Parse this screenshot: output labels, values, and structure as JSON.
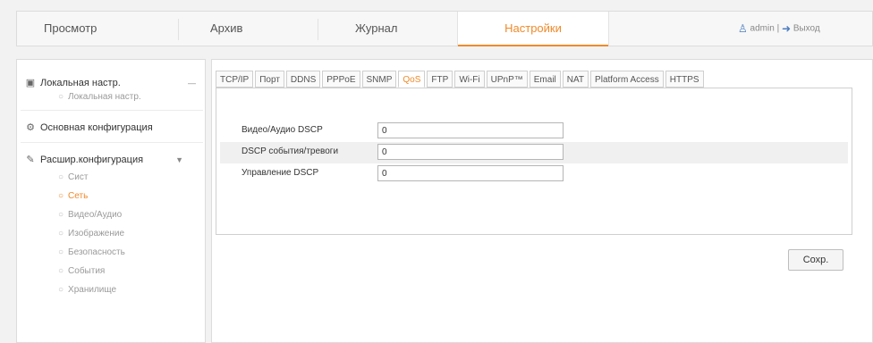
{
  "nav": {
    "tabs": [
      {
        "label": "Просмотр"
      },
      {
        "label": "Архив"
      },
      {
        "label": "Журнал"
      },
      {
        "label": "Настройки"
      }
    ],
    "user": {
      "name": "admin",
      "separator": "|",
      "logout": "Выход"
    }
  },
  "sidebar": {
    "groups": [
      {
        "label": "Локальная настр.",
        "icon": "monitor-icon",
        "items": [
          {
            "label": "Локальная настр."
          }
        ]
      },
      {
        "label": "Основная конфигурация",
        "icon": "gear-icon"
      },
      {
        "label": "Расшир.конфигурация",
        "icon": "wrench-icon",
        "items": [
          {
            "label": "Сист"
          },
          {
            "label": "Сеть"
          },
          {
            "label": "Видео/Аудио"
          },
          {
            "label": "Изображение"
          },
          {
            "label": "Безопасность"
          },
          {
            "label": "События"
          },
          {
            "label": "Хранилище"
          }
        ]
      }
    ]
  },
  "tabs": [
    "TCP/IP",
    "Порт",
    "DDNS",
    "PPPoE",
    "SNMP",
    "QoS",
    "FTP",
    "Wi-Fi",
    "UPnP™",
    "Email",
    "NAT",
    "Platform Access",
    "HTTPS"
  ],
  "form": {
    "rows": [
      {
        "label": "Видео/Аудио DSCP",
        "value": "0"
      },
      {
        "label": "DSCP события/тревоги",
        "value": "0"
      },
      {
        "label": "Управление DSCP",
        "value": "0"
      }
    ],
    "save_label": "Сохр."
  },
  "colors": {
    "accent": "#ef8a2a",
    "border": "#dcdcdc",
    "shaded_row": "#f0f0f0"
  }
}
